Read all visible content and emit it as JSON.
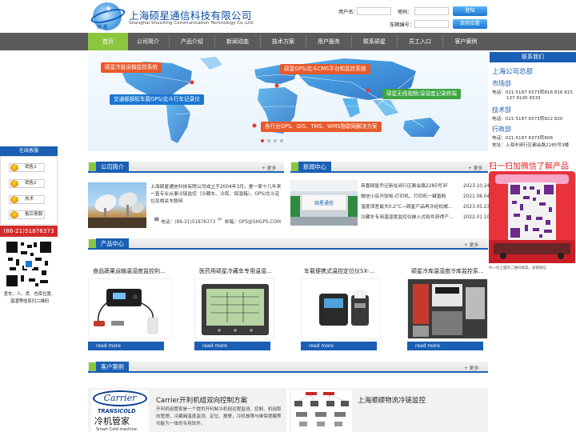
{
  "brand": {
    "logo_text": "硕 星",
    "company_cn": "上海硕星通信科技有限公司",
    "company_en": "Shanghai ShuoXing Communication Technology Co.,Ltd."
  },
  "login": {
    "username_label": "用户名：",
    "password_label": "密码：",
    "login_button": "登陆",
    "vehicle_label": "车辆编号：",
    "locate_button": "目前位置"
  },
  "nav": [
    "首页",
    "公司简介",
    "产品介绍",
    "新闻动态",
    "技术方案",
    "用户服务",
    "联系硕星",
    "员工入口",
    "客户案例"
  ],
  "banner": {
    "tags": [
      "硕星冷链运输监控系统",
      "硕星GPS/北斗CMS平台和监控系统",
      "交通部部标车载GPS/北斗行车记录仪",
      "硕星无线视频/温湿度记录终端",
      "各行业GPS、GIS、TMS、WMS物联网解决方案"
    ]
  },
  "contact": {
    "header": "联系我们",
    "hq_title": "上海公司总部",
    "market_title": "市场部",
    "market_phone": "电话：021-5187 6373转818 816 815",
    "market_phone2": "137 6145 6533",
    "tech_title": "技术部",
    "tech_phone": "电话：021-5187 6373转822 820",
    "admin_title": "行政部",
    "admin_phone": "电话：021-5187 6373转806",
    "address": "地址：上海市闵行区都会路2285号3楼",
    "scan_title": "扫一扫加微信了解产品",
    "qr_note": "扫一扫上面的二维码图案，加我微信"
  },
  "left_float": {
    "header": "在线客服",
    "items": [
      "销售1",
      "销售2",
      "技术",
      "售后客服"
    ],
    "phone": "(86-21)51876373",
    "note": "查车、人、货、仓库位置、温湿等信息扫二维码"
  },
  "about": {
    "title": "公司简介",
    "more": "+ 更多",
    "text": "上海硕星通信科技有限公司成立于2004年3月，是一家十几年来一直专业从事冷链监控（冷藏车、冷库、保温箱）、GPS/北斗定位及相关车联网",
    "phone": "电话：(86-21)51876373",
    "email": "邮箱：GPS@SHGPS.COM"
  },
  "news": {
    "title": "新闻中心",
    "more": "+ 更多",
    "items": [
      {
        "title": "恭喜硕星乔迁新址闵行区都会路2285号3F",
        "date": "2023.10.24"
      },
      {
        "title": "微信小店开张啦-打印机、打印机一键直购",
        "date": "2021.06.04"
      },
      {
        "title": "温度误差最大0.2°C—硕星产品再次经权威...",
        "date": "2023.05.23"
      },
      {
        "title": "冷藏车专用温湿度监控仪嵌入式软件获得产...",
        "date": "2022.01.10"
      }
    ]
  },
  "products": {
    "title": "产品中心",
    "more": "+ 更多",
    "items": [
      {
        "title": "食品蔬果运输温湿度监控利...",
        "link": "read more"
      },
      {
        "title": "医药用硕星冷藏车专用温湿...",
        "link": "read more"
      },
      {
        "title": "车载便携式温控定位仪SX-...",
        "link": "read more"
      },
      {
        "title": "硕星冷库温湿度冷库监控系...",
        "link": "read more"
      }
    ]
  },
  "cases": {
    "title": "客户案例",
    "more": "+ 更多",
    "carrier_logo": "Carrier",
    "carrier_sub": "TRANSICOLD",
    "carrier_cn": "冷机管家",
    "carrier_en": "Smart Cold machine",
    "case1_title": "Carrier开利机组双向控制方案",
    "case1_text": "开利机组管家是一个提供开利制冷机组远程监测、控制、机组取向管理，冷藏厢温度监测、定位、报警，冷机故障与维保提醒等功能为一体的专用软件。",
    "case2_title": "上海顺顺物流冷链监控"
  },
  "colors": {
    "primary": "#1a5fb4",
    "accent": "#8cc63f",
    "nav_bg": "#5b5b5b",
    "phone_bar": "#d32b2b"
  }
}
